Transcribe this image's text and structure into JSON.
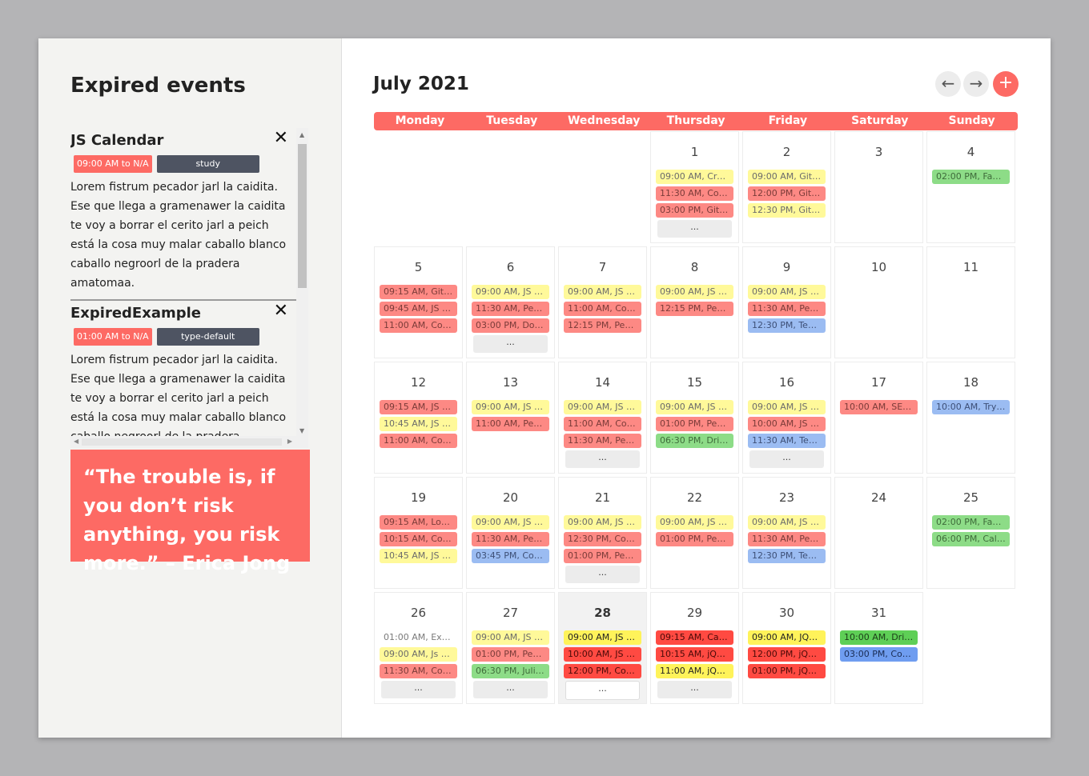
{
  "sidebar": {
    "title": "Expired events",
    "items": [
      {
        "name": "JS Calendar",
        "time": "09:00 AM to N/A",
        "type": "study",
        "desc": "Lorem fistrum pecador jarl la caidita. Ese que llega a gramenawer la caidita te voy a borrar el cerito jarl a peich está la cosa muy malar caballo blanco caballo negroorl de la pradera amatomaa."
      },
      {
        "name": "ExpiredExample",
        "time": "01:00 AM to N/A",
        "type": "type-default",
        "desc": "Lorem fistrum pecador jarl la caidita. Ese que llega a gramenawer la caidita te voy a borrar el cerito jarl a peich está la cosa muy malar caballo blanco caballo negroorl de la pradera amatomaa."
      }
    ],
    "close_glyph": "✕",
    "quote": "“The trouble is, if you don’t risk anything, you risk more.” – Erica Jong"
  },
  "calendar": {
    "month_title": "July 2021",
    "prev_label": "←",
    "next_label": "→",
    "add_label": "+",
    "weekdays": [
      "Monday",
      "Tuesday",
      "Wednesday",
      "Thursday",
      "Friday",
      "Saturday",
      "Sunday"
    ],
    "more_label": "...",
    "today": 28,
    "colors": {
      "accent": "#fd6a64",
      "yellow": "#fff99a",
      "red": "#fd8984",
      "green": "#8ddc87",
      "blue": "#9bbcf2"
    },
    "days": [
      {
        "day": 1,
        "events": [
          {
            "t": "09:00 AM, Creat...",
            "c": "yellow"
          },
          {
            "t": "11:30 AM, Coffe...",
            "c": "red"
          },
          {
            "t": "03:00 PM, Git Ba...",
            "c": "red"
          }
        ],
        "more": true
      },
      {
        "day": 2,
        "events": [
          {
            "t": "09:00 AM, Git Ba...",
            "c": "yellow"
          },
          {
            "t": "12:00 PM, Git Ba...",
            "c": "red"
          },
          {
            "t": "12:30 PM, Git Ba...",
            "c": "yellow"
          }
        ],
        "more": false
      },
      {
        "day": 3,
        "events": [],
        "more": false
      },
      {
        "day": 4,
        "events": [
          {
            "t": "02:00 PM, Famil...",
            "c": "green"
          }
        ],
        "more": false
      },
      {
        "day": 5,
        "events": [
          {
            "t": "09:15 AM, Git Ba...",
            "c": "red"
          },
          {
            "t": "09:45 AM, JS Sh...",
            "c": "red"
          },
          {
            "t": "11:00 AM, Coffe...",
            "c": "red"
          }
        ],
        "more": false
      },
      {
        "day": 6,
        "events": [
          {
            "t": "09:00 AM, JS Sh...",
            "c": "yellow"
          },
          {
            "t": "11:30 AM, Peer ...",
            "c": "red"
          },
          {
            "t": "03:00 PM, DonD...",
            "c": "red"
          }
        ],
        "more": true
      },
      {
        "day": 7,
        "events": [
          {
            "t": "09:00 AM, JS Sh...",
            "c": "yellow"
          },
          {
            "t": "11:00 AM, Coffe...",
            "c": "red"
          },
          {
            "t": "12:15 PM, Peer ...",
            "c": "red"
          }
        ],
        "more": false
      },
      {
        "day": 8,
        "events": [
          {
            "t": "09:00 AM, JS Sh...",
            "c": "yellow"
          },
          {
            "t": "12:15 PM, Peer ...",
            "c": "red"
          }
        ],
        "more": false
      },
      {
        "day": 9,
        "events": [
          {
            "t": "09:00 AM, JS Sh...",
            "c": "yellow"
          },
          {
            "t": "11:30 AM, Peer ...",
            "c": "red"
          },
          {
            "t": "12:30 PM, Team ...",
            "c": "blue"
          }
        ],
        "more": false
      },
      {
        "day": 10,
        "events": [],
        "more": false
      },
      {
        "day": 11,
        "events": [],
        "more": false
      },
      {
        "day": 12,
        "events": [
          {
            "t": "09:15 AM, JS Sh...",
            "c": "red"
          },
          {
            "t": "10:45 AM, JS Pla...",
            "c": "yellow"
          },
          {
            "t": "11:00 AM, Coffe...",
            "c": "red"
          }
        ],
        "more": false
      },
      {
        "day": 13,
        "events": [
          {
            "t": "09:00 AM, JS Pla...",
            "c": "yellow"
          },
          {
            "t": "11:00 AM, Peer ...",
            "c": "red"
          }
        ],
        "more": false
      },
      {
        "day": 14,
        "events": [
          {
            "t": "09:00 AM, JS Pla...",
            "c": "yellow"
          },
          {
            "t": "11:00 AM, Coffe...",
            "c": "red"
          },
          {
            "t": "11:30 AM, Peer ...",
            "c": "red"
          }
        ],
        "more": true
      },
      {
        "day": 15,
        "events": [
          {
            "t": "09:00 AM, JS Pla...",
            "c": "yellow"
          },
          {
            "t": "01:00 PM, Peer ...",
            "c": "red"
          },
          {
            "t": "06:30 PM, Drivin...",
            "c": "green"
          }
        ],
        "more": false
      },
      {
        "day": 16,
        "events": [
          {
            "t": "09:00 AM, JS Pla...",
            "c": "yellow"
          },
          {
            "t": "10:00 AM, JS Pla...",
            "c": "red"
          },
          {
            "t": "11:30 AM, Team ...",
            "c": "blue"
          }
        ],
        "more": true
      },
      {
        "day": 17,
        "events": [
          {
            "t": "10:00 AM, SEO ...",
            "c": "red"
          }
        ],
        "more": false
      },
      {
        "day": 18,
        "events": [
          {
            "t": "10:00 AM, Try C...",
            "c": "blue"
          }
        ],
        "more": false
      },
      {
        "day": 19,
        "events": [
          {
            "t": "09:15 AM, Local...",
            "c": "red"
          },
          {
            "t": "10:15 AM, Coffe...",
            "c": "red"
          },
          {
            "t": "10:45 AM, JS Cal...",
            "c": "yellow"
          }
        ],
        "more": false
      },
      {
        "day": 20,
        "events": [
          {
            "t": "09:00 AM, JS Cal...",
            "c": "yellow"
          },
          {
            "t": "11:30 AM, Peer ...",
            "c": "red"
          },
          {
            "t": "03:45 PM, CoVid...",
            "c": "blue"
          }
        ],
        "more": false
      },
      {
        "day": 21,
        "events": [
          {
            "t": "09:00 AM, JS Cal...",
            "c": "yellow"
          },
          {
            "t": "12:30 PM, Coffe...",
            "c": "red"
          },
          {
            "t": "01:00 PM, Peer ...",
            "c": "red"
          }
        ],
        "more": true
      },
      {
        "day": 22,
        "events": [
          {
            "t": "09:00 AM, JS Cal...",
            "c": "yellow"
          },
          {
            "t": "01:00 PM, Peer ...",
            "c": "red"
          }
        ],
        "more": false
      },
      {
        "day": 23,
        "events": [
          {
            "t": "09:00 AM, JS Cal...",
            "c": "yellow"
          },
          {
            "t": "11:30 AM, Peer ...",
            "c": "red"
          },
          {
            "t": "12:30 PM, Team ...",
            "c": "blue"
          }
        ],
        "more": false
      },
      {
        "day": 24,
        "events": [],
        "more": false
      },
      {
        "day": 25,
        "events": [
          {
            "t": "02:00 PM, Famil...",
            "c": "green"
          },
          {
            "t": "06:00 PM, Call C...",
            "c": "green"
          }
        ],
        "more": false
      },
      {
        "day": 26,
        "events": [
          {
            "t": "01:00 AM, Expir...",
            "c": "plain"
          },
          {
            "t": "09:00 AM, Js Cal...",
            "c": "yellow"
          },
          {
            "t": "11:30 AM, Cofee...",
            "c": "red"
          }
        ],
        "more": true
      },
      {
        "day": 27,
        "events": [
          {
            "t": "09:00 AM, JS Cal...",
            "c": "yellow"
          },
          {
            "t": "01:00 PM, Peer ...",
            "c": "red"
          },
          {
            "t": "06:30 PM, Julia's...",
            "c": "green"
          }
        ],
        "more": true
      },
      {
        "day": 28,
        "events": [
          {
            "t": "09:00 AM, JS Cal...",
            "c": "yellow-s"
          },
          {
            "t": "10:00 AM, JS Cal...",
            "c": "red-s"
          },
          {
            "t": "12:00 PM, Coffe...",
            "c": "red-s"
          }
        ],
        "more": true
      },
      {
        "day": 29,
        "events": [
          {
            "t": "09:15 AM, Callb...",
            "c": "red-s"
          },
          {
            "t": "10:15 AM, jQuer...",
            "c": "red-s"
          },
          {
            "t": "11:00 AM, jQuer...",
            "c": "yellow-s"
          }
        ],
        "more": true
      },
      {
        "day": 30,
        "events": [
          {
            "t": "09:00 AM, JQuer...",
            "c": "yellow-s"
          },
          {
            "t": "12:00 PM, jQuer...",
            "c": "red-s"
          },
          {
            "t": "01:00 PM, jQuer...",
            "c": "red-s"
          }
        ],
        "more": false
      },
      {
        "day": 31,
        "events": [
          {
            "t": "10:00 AM, Drivin...",
            "c": "green-s"
          },
          {
            "t": "03:00 PM, Core ...",
            "c": "blue-s"
          }
        ],
        "more": false
      }
    ]
  }
}
